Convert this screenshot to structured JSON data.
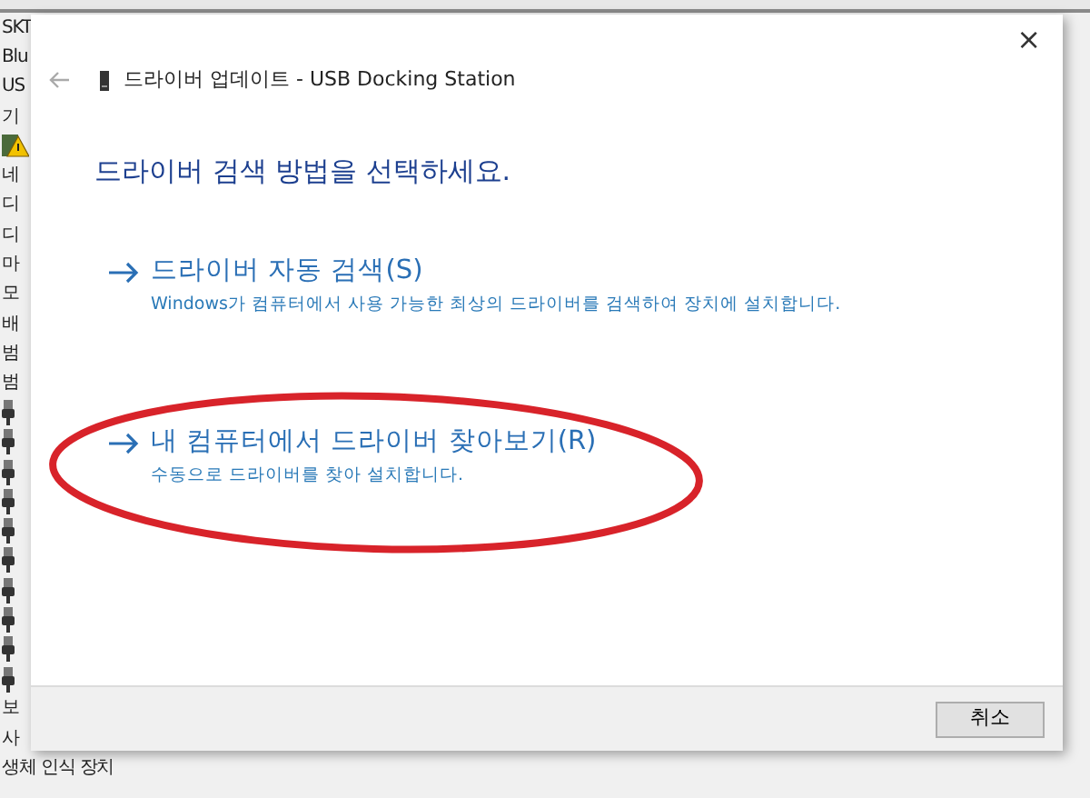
{
  "background_tree": {
    "items": [
      {
        "kind": "text",
        "label": "SKT"
      },
      {
        "kind": "text",
        "label": "Blu"
      },
      {
        "kind": "text",
        "label": "US"
      },
      {
        "kind": "text",
        "label": "기"
      },
      {
        "kind": "warning-device"
      },
      {
        "kind": "text",
        "label": "네"
      },
      {
        "kind": "text",
        "label": "디"
      },
      {
        "kind": "text",
        "label": "디"
      },
      {
        "kind": "text",
        "label": "마"
      },
      {
        "kind": "text",
        "label": "모"
      },
      {
        "kind": "text",
        "label": "배"
      },
      {
        "kind": "text",
        "label": "범"
      },
      {
        "kind": "text",
        "label": "범"
      },
      {
        "kind": "usb"
      },
      {
        "kind": "usb"
      },
      {
        "kind": "usb"
      },
      {
        "kind": "usb"
      },
      {
        "kind": "usb"
      },
      {
        "kind": "usb"
      },
      {
        "kind": "usb"
      },
      {
        "kind": "usb"
      },
      {
        "kind": "usb"
      },
      {
        "kind": "usb"
      },
      {
        "kind": "text",
        "label": "보"
      },
      {
        "kind": "text",
        "label": "사"
      },
      {
        "kind": "text",
        "label": "생체 인식 장치"
      }
    ]
  },
  "dialog": {
    "close_glyph": "×",
    "title": "드라이버 업데이트 - USB Docking Station",
    "heading": "드라이버 검색 방법을 선택하세요.",
    "options": [
      {
        "title": "드라이버 자동 검색(S)",
        "description": "Windows가 컴퓨터에서 사용 가능한 최상의 드라이버를 검색하여 장치에 설치합니다.",
        "highlighted": false
      },
      {
        "title": "내 컴퓨터에서 드라이버 찾아보기(R)",
        "description": "수동으로 드라이버를 찾아 설치합니다.",
        "highlighted": true
      }
    ],
    "buttons": [
      "취소"
    ]
  }
}
